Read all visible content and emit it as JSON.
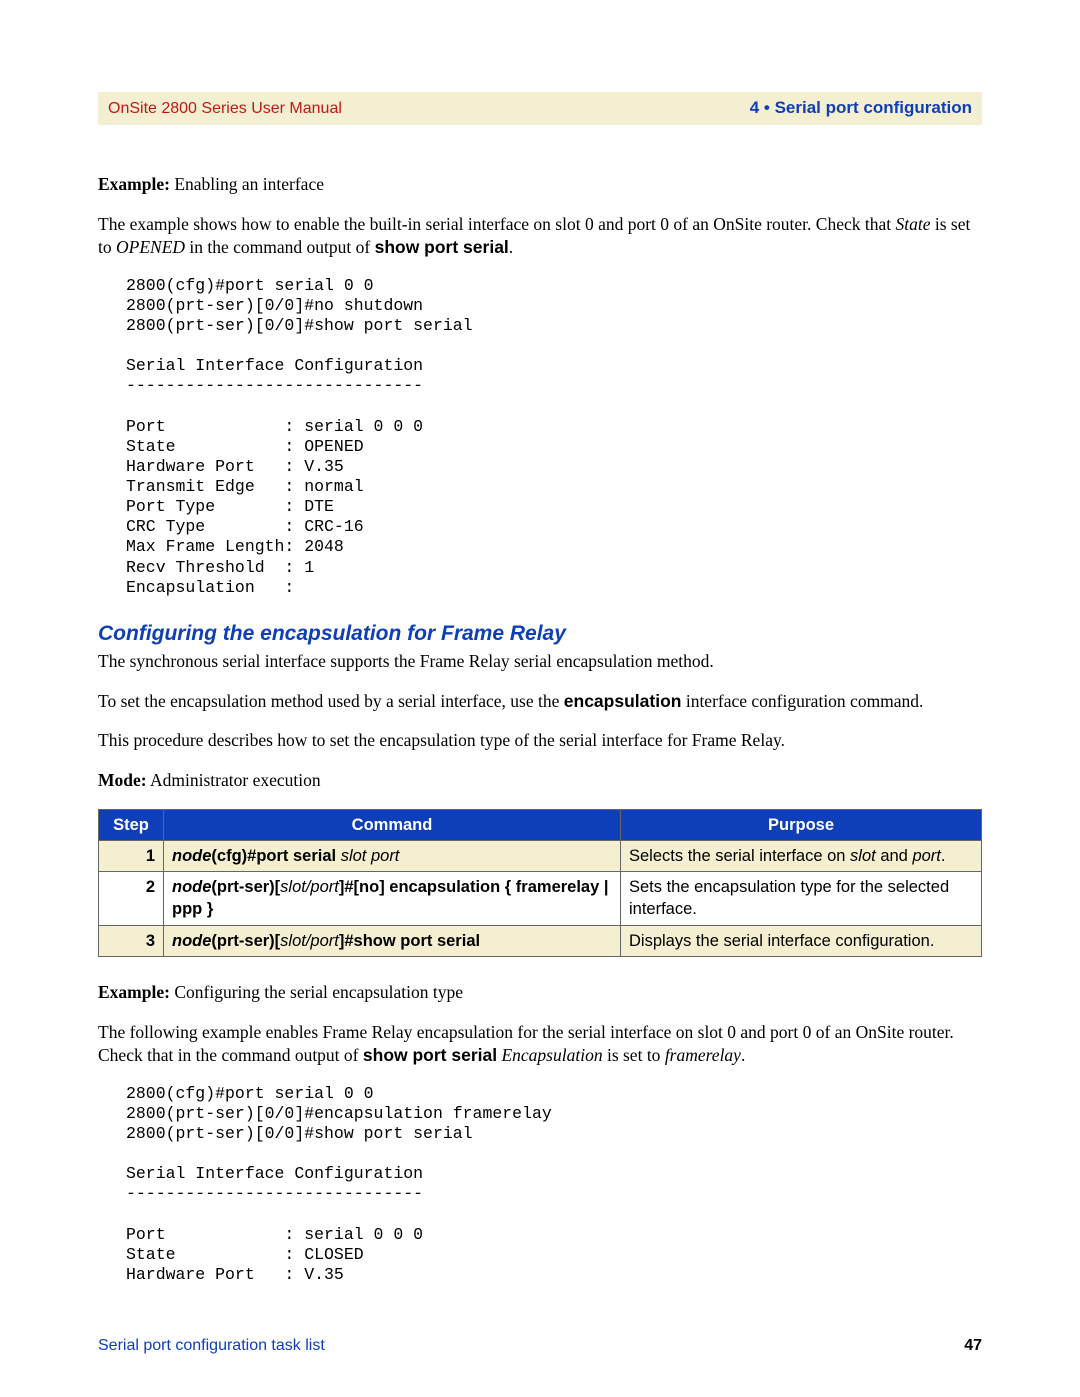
{
  "header": {
    "left": "OnSite 2800 Series User Manual",
    "right": "4 • Serial port configuration"
  },
  "example1": {
    "label": "Example:",
    "text": " Enabling an interface"
  },
  "intro1_1": "The example shows how to enable the built-in serial interface on slot 0 and port 0 of an OnSite router. Check that ",
  "intro1_state": "State",
  "intro1_2": " is set to ",
  "intro1_opened": "OPENED",
  "intro1_3": " in the command output of ",
  "intro1_cmd": "show port serial",
  "intro1_4": ".",
  "code1": "2800(cfg)#port serial 0 0\n2800(prt-ser)[0/0]#no shutdown\n2800(prt-ser)[0/0]#show port serial\n\nSerial Interface Configuration\n------------------------------\n\nPort            : serial 0 0 0\nState           : OPENED\nHardware Port   : V.35\nTransmit Edge   : normal\nPort Type       : DTE\nCRC Type        : CRC-16\nMax Frame Length: 2048\nRecv Threshold  : 1\nEncapsulation   :",
  "section_title": "Configuring the encapsulation for Frame Relay",
  "p2": "The synchronous serial interface supports the Frame Relay serial encapsulation method.",
  "p3_1": "To set the encapsulation method used by a serial interface, use the ",
  "p3_cmd": "encapsulation",
  "p3_2": " interface configuration command.",
  "p4": "This procedure describes how to set the encapsulation type of the serial interface for Frame Relay.",
  "mode": {
    "label": "Mode:",
    "text": " Administrator execution"
  },
  "table": {
    "headers": {
      "step": "Step",
      "command": "Command",
      "purpose": "Purpose"
    },
    "rows": [
      {
        "step": "1",
        "cmd1": "node",
        "cmd2": "(cfg)#port serial ",
        "cmd3": "slot port",
        "purpose1": "Selects the serial interface on ",
        "purpose_slot": "slot",
        "purpose_and": " and ",
        "purpose_port": "port",
        "purpose_end": "."
      },
      {
        "step": "2",
        "cmd1": "node",
        "cmd2": "(prt-ser)[",
        "cmd3": "slot/port",
        "cmd4": "]#[no] encapsulation { framerelay | ppp }",
        "purpose": "Sets the encapsulation type for the selected interface."
      },
      {
        "step": "3",
        "cmd1": "node",
        "cmd2": "(prt-ser)[",
        "cmd3": "slot/port",
        "cmd4": "]#show port serial",
        "purpose": "Displays the serial interface configuration."
      }
    ]
  },
  "example2": {
    "label": "Example:",
    "text": " Configuring the serial encapsulation type"
  },
  "p5_1": "The following example enables Frame Relay encapsulation for the serial interface on slot 0 and port 0 of an OnSite router. Check that in the command output of ",
  "p5_cmd": "show port serial",
  "p5_2": " ",
  "p5_encap": "Encapsulation",
  "p5_3": " is set to ",
  "p5_fr": "framerelay",
  "p5_4": ".",
  "code2": "2800(cfg)#port serial 0 0\n2800(prt-ser)[0/0]#encapsulation framerelay\n2800(prt-ser)[0/0]#show port serial\n\nSerial Interface Configuration\n------------------------------\n\nPort            : serial 0 0 0\nState           : CLOSED\nHardware Port   : V.35",
  "footer": {
    "left": "Serial port configuration task list",
    "right": "47"
  }
}
